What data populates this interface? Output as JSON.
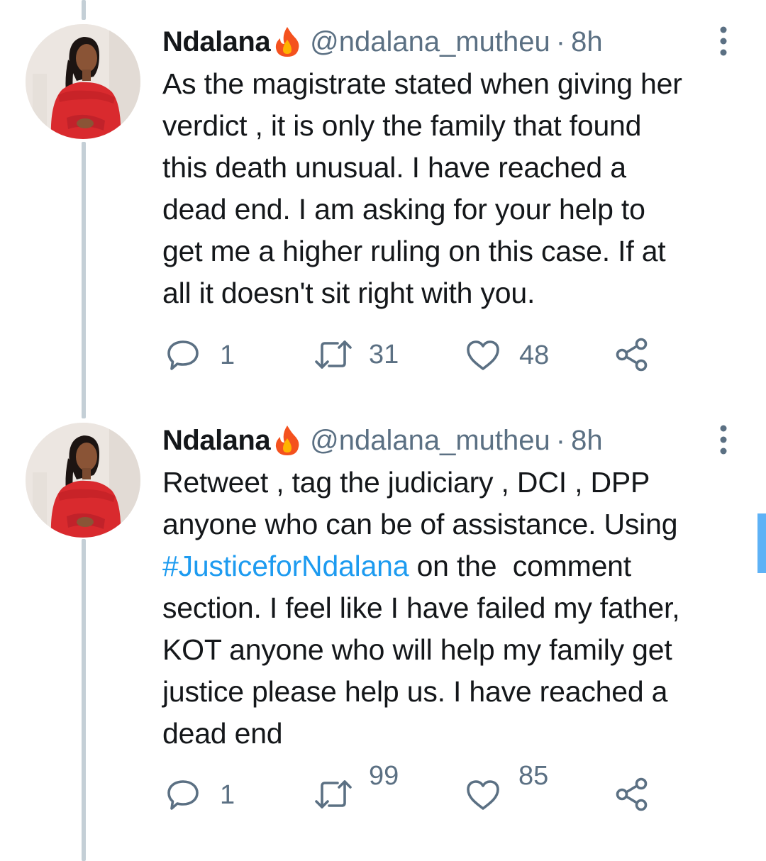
{
  "tweets": [
    {
      "display_name": "Ndalana",
      "emoji": "fire-icon",
      "handle": "@ndalana_mutheu",
      "separator": "·",
      "time": "8h",
      "text": "As the magistrate stated when giving her\nverdict , it is only the family that found\nthis death unusual. I have reached a\ndead end. I am asking for your help to\nget me a higher ruling on this case. If at\nall it doesn't sit right with you.",
      "replies": "1",
      "retweets": "31",
      "likes": "48"
    },
    {
      "display_name": "Ndalana",
      "emoji": "fire-icon",
      "handle": "@ndalana_mutheu",
      "separator": "·",
      "time": "8h",
      "text_before_hashtag": "Retweet , tag the judiciary , DCI , DPP\nanyone who can be of assistance. Using\n",
      "hashtag": "#JusticeforNdalana",
      "text_after_hashtag": " on the  comment\nsection. I feel like I have failed my father,\nKOT anyone who will help my family get\njustice please help us. I have reached a\ndead end",
      "replies": "1",
      "retweets": "99",
      "likes": "85"
    }
  ],
  "colors": {
    "text": "#14171a",
    "secondary": "#5b7083",
    "link": "#1d9bf0",
    "thread_line": "#c4cfd6",
    "fire": "#f4511e"
  }
}
